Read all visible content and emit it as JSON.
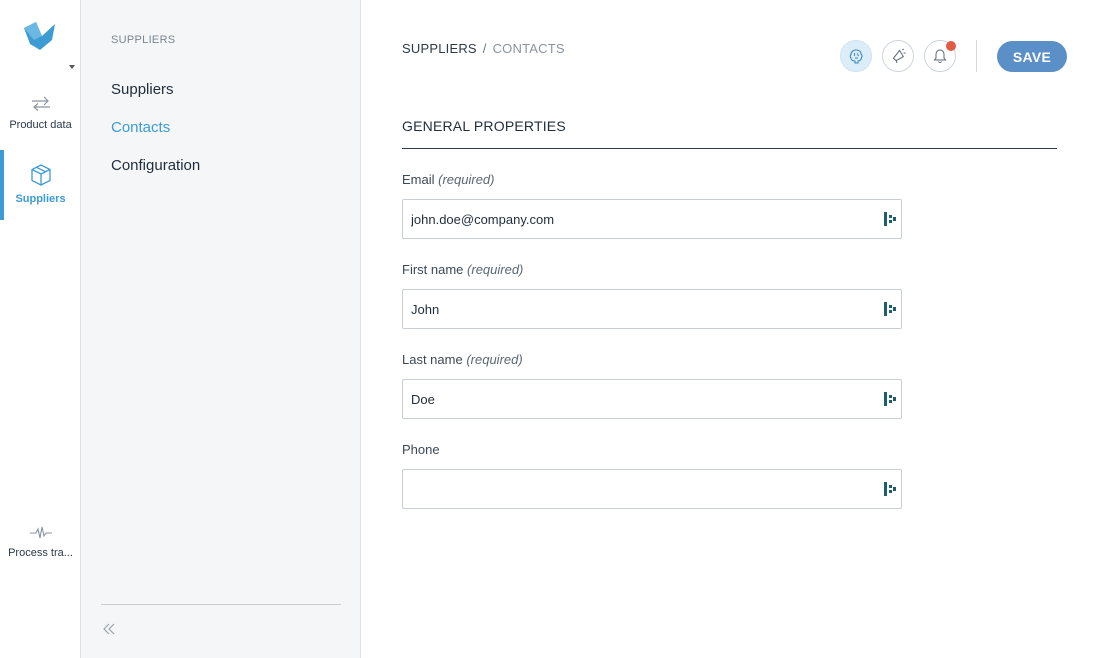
{
  "rail": {
    "logo": "brand-logo",
    "items": [
      {
        "label": "Product data",
        "icon": "arrows-exchange-icon"
      },
      {
        "label": "Suppliers",
        "icon": "box-icon"
      },
      {
        "label": "Process tra...",
        "icon": "pulse-icon"
      }
    ],
    "accent": "#3d9bd4"
  },
  "subnav": {
    "title": "SUPPLIERS",
    "items": [
      {
        "label": "Suppliers"
      },
      {
        "label": "Contacts"
      },
      {
        "label": "Configuration"
      }
    ]
  },
  "header": {
    "breadcrumb": {
      "parent": "SUPPLIERS",
      "separator": "/",
      "current": "CONTACTS"
    },
    "save_label": "SAVE",
    "icons": [
      "brain-icon",
      "megaphone-icon",
      "bell-icon"
    ],
    "save_color": "#5b8fc7",
    "notification_color": "#e05a44"
  },
  "form": {
    "section_title": "GENERAL PROPERTIES",
    "required_text": "(required)",
    "fields": [
      {
        "label": "Email",
        "required": true,
        "value": "john.doe@company.com"
      },
      {
        "label": "First name",
        "required": true,
        "value": "John"
      },
      {
        "label": "Last name",
        "required": true,
        "value": "Doe"
      },
      {
        "label": "Phone",
        "required": false,
        "value": ""
      }
    ]
  }
}
